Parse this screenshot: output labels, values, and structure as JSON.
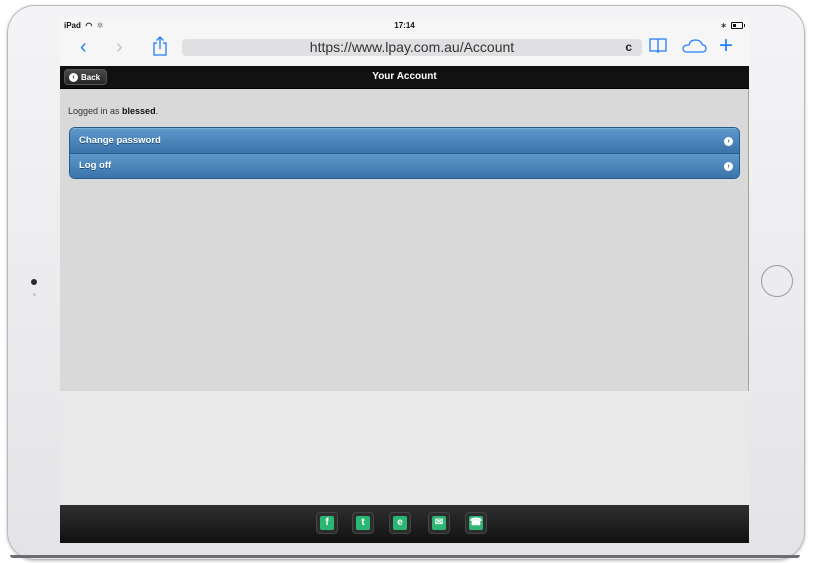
{
  "status_bar": {
    "device": "iPad",
    "time": "17:14"
  },
  "browser": {
    "back_glyph": "‹",
    "forward_glyph": "›",
    "url": "https://www.lpay.com.au/Account",
    "reload_glyph": "c",
    "plus_glyph": "+",
    "accent_color": "#1f7ef5"
  },
  "header": {
    "back_label": "Back",
    "back_glyph": "‹",
    "title": "Your Account"
  },
  "account": {
    "logged_prefix": "Logged in as ",
    "username": "blessed",
    "logged_suffix": ".",
    "menu": [
      {
        "label": "Change password",
        "icon": "chevron-right-icon"
      },
      {
        "label": "Log off",
        "icon": "chevron-right-icon"
      }
    ],
    "chevron_glyph": "›",
    "list_color": "#4a85bb"
  },
  "footer": {
    "icon_color": "#2bb673",
    "icons": [
      {
        "name": "facebook-icon",
        "glyph": "f"
      },
      {
        "name": "twitter-icon",
        "glyph": "t"
      },
      {
        "name": "web-icon",
        "glyph": "e"
      },
      {
        "name": "email-icon",
        "glyph": "✉"
      },
      {
        "name": "phone-icon",
        "glyph": "☎"
      }
    ]
  }
}
